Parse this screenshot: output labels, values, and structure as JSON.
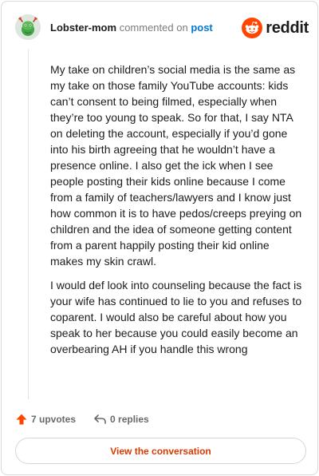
{
  "comment": {
    "username": "Lobster-mom",
    "action_text": "commented on",
    "post_link": "post",
    "paragraphs": [
      "My take on children’s social media is the same as my take on those family YouTube accounts: kids can’t consent to being filmed, especially when they’re too young to speak. So for that, I say NTA on deleting the account, especially if you’d gone into his birth agreeing that he wouldn’t have a presence online. I also get the ick when I see people posting their kids online because I come from a family of teachers/lawyers and I know just how common it is to have pedos/creeps preying on children and the idea of someone getting content from a parent happily posting their kid online makes my skin crawl.",
      "I would def look into counseling because the fact is your wife has continued to lie to you and refuses to coparent. I would also be careful about how you speak to her because you could easily become an overbearing AH if you handle this wrong"
    ],
    "upvotes_label": "7 upvotes",
    "replies_label": "0 replies"
  },
  "brand": {
    "wordmark": "reddit",
    "color": "#ff4500"
  },
  "cta": {
    "label": "View the conversation",
    "color": "#d93a00"
  },
  "icons": {
    "upvote": "upvote-arrow-icon",
    "reply": "reply-arrow-icon",
    "avatar": "snoo-avatar-icon",
    "logo": "reddit-logo-icon"
  }
}
